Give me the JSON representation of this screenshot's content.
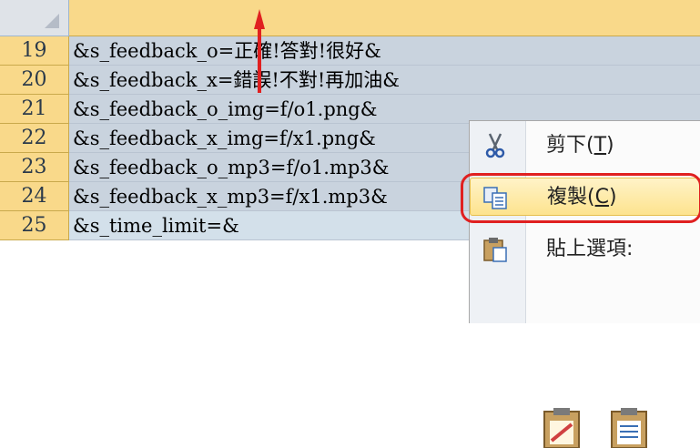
{
  "rows": [
    {
      "num": "19",
      "text": "&s_feedback_o=正確!答對!很好&"
    },
    {
      "num": "20",
      "text": "&s_feedback_x=錯誤!不對!再加油&"
    },
    {
      "num": "21",
      "text": "&s_feedback_o_img=f/o1.png&"
    },
    {
      "num": "22",
      "text": "&s_feedback_x_img=f/x1.png&"
    },
    {
      "num": "23",
      "text": "&s_feedback_o_mp3=f/o1.mp3&"
    },
    {
      "num": "24",
      "text": "&s_feedback_x_mp3=f/x1.mp3&"
    },
    {
      "num": "25",
      "text": "&s_time_limit=&"
    }
  ],
  "menu": {
    "cut": {
      "label": "剪下(",
      "key": "T",
      "end": ")",
      "icon": "scissors-icon"
    },
    "copy": {
      "label": "複製(",
      "key": "C",
      "end": ")",
      "icon": "copy-icon"
    },
    "paste_options": {
      "label": "貼上選項:",
      "icon": "clipboard-icon"
    }
  },
  "colors": {
    "accent_arrow": "#e02020",
    "highlight_ring": "#e02020",
    "header_bg": "#f9d98a"
  }
}
